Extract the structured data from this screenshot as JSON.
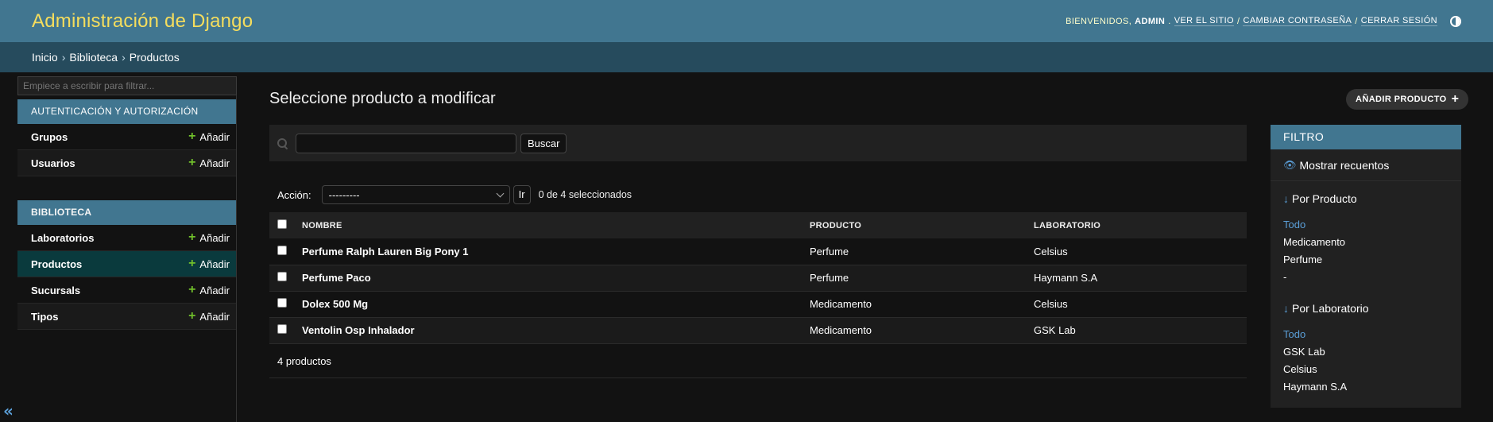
{
  "header": {
    "branding": "Administración de Django",
    "welcome": "BIENVENIDOS,",
    "username": "ADMIN",
    "view_site": "VER EL SITIO",
    "change_password": "CAMBIAR CONTRASEÑA",
    "logout": "CERRAR SESIÓN",
    "sep": "/"
  },
  "breadcrumbs": {
    "home": "Inicio",
    "app": "Biblioteca",
    "current": "Productos",
    "sep": "›"
  },
  "sidebar": {
    "filter_placeholder": "Empiece a escribir para filtrar...",
    "modules": [
      {
        "caption": "AUTENTICACIÓN Y AUTORIZACIÓN",
        "rows": [
          {
            "name": "Grupos",
            "add": "Añadir"
          },
          {
            "name": "Usuarios",
            "add": "Añadir"
          }
        ]
      },
      {
        "caption": "BIBLIOTECA",
        "rows": [
          {
            "name": "Laboratorios",
            "add": "Añadir"
          },
          {
            "name": "Productos",
            "add": "Añadir"
          },
          {
            "name": "Sucursals",
            "add": "Añadir"
          },
          {
            "name": "Tipos",
            "add": "Añadir"
          }
        ]
      }
    ],
    "toggle": "«"
  },
  "content": {
    "title": "Seleccione producto a modificar",
    "add_button": "AÑADIR PRODUCTO",
    "search_button": "Buscar",
    "action_label": "Acción:",
    "action_selected": "---------",
    "go_button": "Ir",
    "action_counter": "0 de 4 seleccionados",
    "table": {
      "headers": [
        "NOMBRE",
        "PRODUCTO",
        "LABORATORIO"
      ],
      "rows": [
        [
          "Perfume Ralph Lauren Big Pony 1",
          "Perfume",
          "Celsius"
        ],
        [
          "Perfume Paco",
          "Perfume",
          "Haymann S.A"
        ],
        [
          "Dolex 500 Mg",
          "Medicamento",
          "Celsius"
        ],
        [
          "Ventolin Osp Inhalador",
          "Medicamento",
          "GSK Lab"
        ]
      ]
    },
    "paginator": "4 productos"
  },
  "filter": {
    "title": "FILTRO",
    "show_counts": "Mostrar recuentos",
    "sections": [
      {
        "title": "Por Producto",
        "choices": [
          "Todo",
          "Medicamento",
          "Perfume",
          "-"
        ]
      },
      {
        "title": "Por Laboratorio",
        "choices": [
          "Todo",
          "GSK Lab",
          "Celsius",
          "Haymann S.A"
        ]
      }
    ]
  },
  "colors": {
    "header_bg": "#417690",
    "breadcrumbs_bg": "#264b5d",
    "branding": "#f5dd5d",
    "accent_link": "#5b9fd8",
    "add_plus": "#70bf2b",
    "current_row_bg": "#0a3a3d"
  }
}
